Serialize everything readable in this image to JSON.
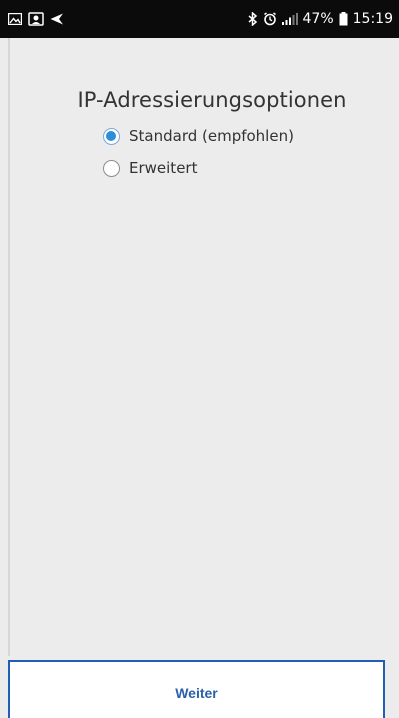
{
  "status_bar": {
    "left_icons": [
      "image-icon",
      "face-unlock-icon",
      "send-icon"
    ],
    "right_icons": [
      "bluetooth-icon",
      "alarm-icon",
      "signal-icon",
      "battery-icon"
    ],
    "battery_percent": "47%",
    "time": "15:19"
  },
  "screen": {
    "title": "IP-Adressierungsoptionen",
    "options": [
      {
        "label": "Standard (empfohlen)",
        "selected": true
      },
      {
        "label": "Erweitert",
        "selected": false
      }
    ]
  },
  "footer": {
    "next_label": "Weiter"
  },
  "colors": {
    "accent": "#2a8fd8",
    "button_border": "#1f5fb4",
    "button_text": "#2b5fa8",
    "background": "#ececec"
  }
}
